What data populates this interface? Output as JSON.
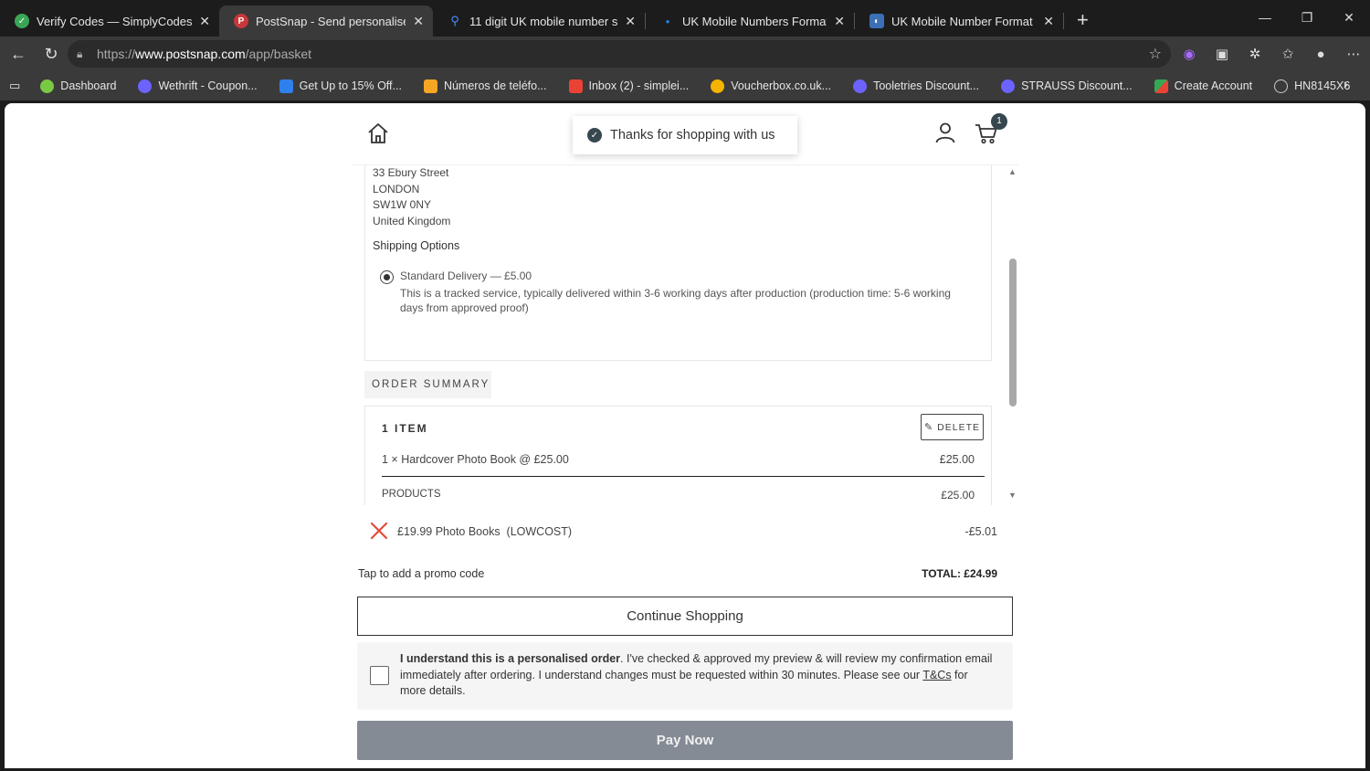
{
  "browser": {
    "tabs": [
      {
        "title": "Verify Codes — SimplyCodes",
        "active": false,
        "favicon_color": "#3aa655"
      },
      {
        "title": "PostSnap - Send personalised pho",
        "active": true,
        "favicon_color": "#c9373b"
      },
      {
        "title": "11 digit UK mobile number startin",
        "active": false,
        "favicon_color": "#4a8cff"
      },
      {
        "title": "UK Mobile Numbers Format and P",
        "active": false,
        "favicon_color": "#1e88e5"
      },
      {
        "title": "UK Mobile Number Format Guide",
        "active": false,
        "favicon_color": "#3b6fb6"
      }
    ],
    "url_prefix": "https://",
    "url_host": "www.postsnap.com",
    "url_path": "/app/basket",
    "bookmarks": [
      {
        "label": "Dashboard",
        "color": "#7ac943"
      },
      {
        "label": "Wethrift - Coupon...",
        "color": "#6c63ff"
      },
      {
        "label": "Get Up to 15% Off...",
        "color": "#2f80ed"
      },
      {
        "label": "Números de teléfo...",
        "color": "#f5a623"
      },
      {
        "label": "Inbox (2) - simplei...",
        "color": "#ea4335"
      },
      {
        "label": "Voucherbox.co.uk...",
        "color": "#f4b400"
      },
      {
        "label": "Tooletries Discount...",
        "color": "#6c63ff"
      },
      {
        "label": "STRAUSS Discount...",
        "color": "#6c63ff"
      },
      {
        "label": "Create Account",
        "color": "#34a853"
      },
      {
        "label": "HN8145X6",
        "color": "#cccccc"
      }
    ]
  },
  "header": {
    "toast": "Thanks for shopping with us",
    "cart_count": "1"
  },
  "address": {
    "lines": [
      "33 Ebury Street",
      "LONDON",
      "SW1W 0NY",
      "United Kingdom"
    ]
  },
  "shipping": {
    "title": "Shipping Options",
    "option_name": "Standard Delivery — £5.00",
    "option_desc": "This is a tracked service, typically delivered within 3-6 working days after production (production time: 5-6 working days from approved proof)"
  },
  "summary": {
    "tab_label": "ORDER SUMMARY",
    "items_count": "1 ITEM",
    "delete_label": "DELETE",
    "item_line": "1 × Hardcover Photo Book @ £25.00",
    "item_price": "£25.00",
    "products_label": "PRODUCTS",
    "products_price": "£25.00"
  },
  "promo": {
    "text": "£19.99 Photo Books  (LOWCOST)",
    "amount": "-£5.01",
    "add_link": "Tap to add a promo code",
    "total": "TOTAL: £24.99"
  },
  "actions": {
    "continue_label": "Continue Shopping",
    "agree_bold": "I understand this is a personalised order",
    "agree_rest": ". I've checked & approved my preview & will review my confirmation email immediately after ordering. I understand changes must be requested within 30 minutes. Please see our ",
    "agree_link": "T&Cs",
    "agree_end": " for more details.",
    "pay_label": "Pay Now"
  }
}
